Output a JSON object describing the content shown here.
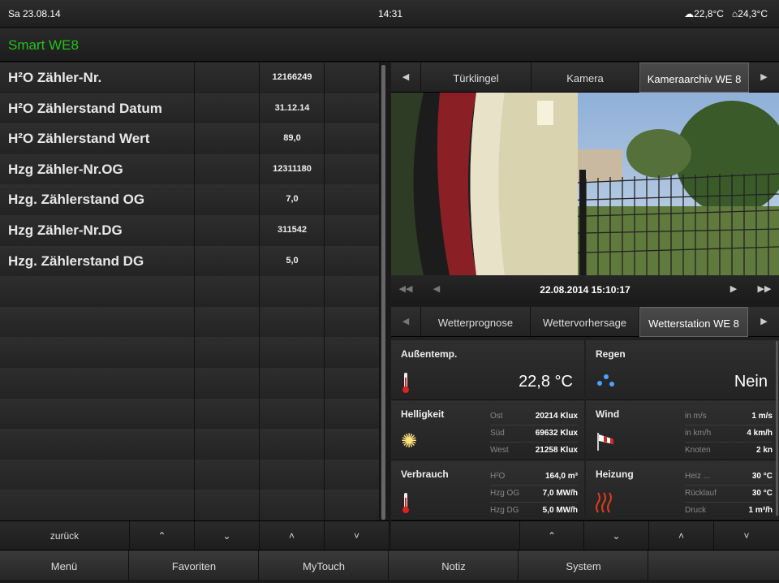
{
  "status": {
    "date": "Sa 23.08.14",
    "time": "14:31",
    "outside_temp": "22,8°C",
    "inside_temp": "24,3°C"
  },
  "title": "Smart WE8",
  "rows": [
    {
      "label": "H²O Zähler-Nr.",
      "value": "12166249"
    },
    {
      "label": "H²O Zählerstand Datum",
      "value": "31.12.14"
    },
    {
      "label": "H²O Zählerstand Wert",
      "value": "89,0"
    },
    {
      "label": "Hzg Zähler-Nr.OG",
      "value": "12311180"
    },
    {
      "label": "Hzg. Zählerstand OG",
      "value": "7,0"
    },
    {
      "label": "Hzg Zähler-Nr.DG",
      "value": "311542"
    },
    {
      "label": "Hzg. Zählerstand DG",
      "value": "5,0"
    }
  ],
  "left_footer": {
    "back": "zurück"
  },
  "camera": {
    "tabs": [
      "Türklingel",
      "Kamera",
      "Kameraarchiv WE 8"
    ],
    "timestamp": "22.08.2014 15:10:17"
  },
  "weather_tabs": [
    "Wetterprognose",
    "Wettervorhersage",
    "Wetterstation WE 8"
  ],
  "weather": {
    "aussen": {
      "title": "Außentemp.",
      "value": "22,8 °C"
    },
    "regen": {
      "title": "Regen",
      "value": "Nein"
    },
    "helligkeit": {
      "title": "Helligkeit",
      "rows": [
        [
          "Ost",
          "20214 Klux"
        ],
        [
          "Süd",
          "69632 Klux"
        ],
        [
          "West",
          "21258 Klux"
        ]
      ]
    },
    "wind": {
      "title": "Wind",
      "rows": [
        [
          "in m/s",
          "1 m/s"
        ],
        [
          "in km/h",
          "4 km/h"
        ],
        [
          "Knoten",
          "2 kn"
        ]
      ]
    },
    "verbrauch": {
      "title": "Verbrauch",
      "rows": [
        [
          "H²O",
          "164,0  m³"
        ],
        [
          "Hzg OG",
          "7,0 MW/h"
        ],
        [
          "Hzg DG",
          "5,0 MW/h"
        ]
      ]
    },
    "heizung": {
      "title": "Heizung",
      "rows": [
        [
          "Heiz ...",
          "30 °C"
        ],
        [
          "Rücklauf",
          "30 °C"
        ],
        [
          "Druck",
          "1 m³/h"
        ]
      ]
    }
  },
  "menu": [
    "Menü",
    "Favoriten",
    "MyTouch",
    "Notiz",
    "System",
    ""
  ],
  "colors": {
    "accent": "#23c21c",
    "background": "#1b1b1b"
  }
}
